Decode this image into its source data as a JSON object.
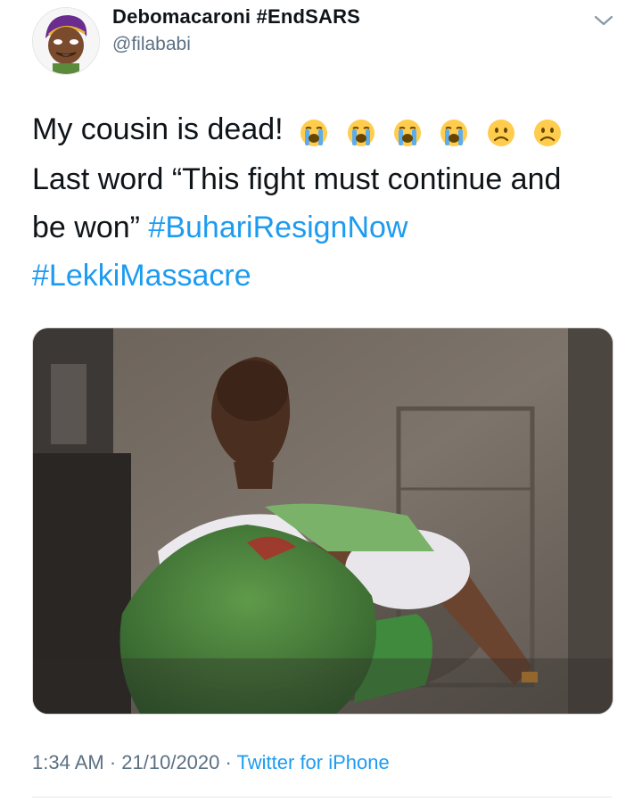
{
  "author": {
    "display_name": "Debomacaroni #EndSARS",
    "handle": "@filababi",
    "avatar_icon": "cartoon-avatar-icon"
  },
  "tweet": {
    "line1": "My cousin is dead!",
    "line1_emojis": [
      "loudly-crying-face-icon",
      "loudly-crying-face-icon",
      "loudly-crying-face-icon",
      "loudly-crying-face-icon",
      "frowning-face-icon",
      "frowning-face-icon"
    ],
    "line2": "Last word “This fight must continue and",
    "line3": "be won”",
    "hashtag1": "#BuhariResignNow",
    "hashtag2": "#LekkiMassacre"
  },
  "meta": {
    "time": "1:34 AM",
    "separator": " · ",
    "date": "21/10/2020",
    "source": "Twitter for iPhone"
  },
  "colors": {
    "link": "#1d9bf0",
    "secondary_text": "#5b7083",
    "primary_text": "#0f1419"
  }
}
